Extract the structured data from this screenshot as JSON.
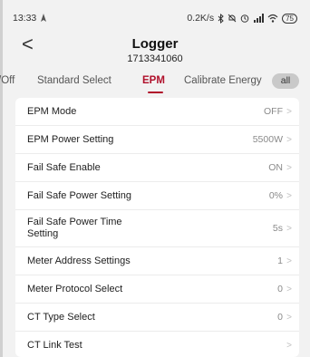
{
  "status_bar": {
    "time": "13:33",
    "speed": "0.2K/s",
    "battery": "75"
  },
  "header": {
    "back_label": "<",
    "title": "Logger",
    "serial": "1713341060"
  },
  "tabs": [
    {
      "label": "/Off",
      "active": false
    },
    {
      "label": "Standard Select",
      "active": false
    },
    {
      "label": "EPM",
      "active": true
    },
    {
      "label": "Calibrate Energy",
      "active": false
    }
  ],
  "all_button": "all",
  "settings": [
    {
      "label": "EPM Mode",
      "value": "OFF"
    },
    {
      "label": "EPM Power Setting",
      "value": "5500W"
    },
    {
      "label": "Fail Safe Enable",
      "value": "ON"
    },
    {
      "label": "Fail Safe Power Setting",
      "value": "0%"
    },
    {
      "label": "Fail Safe Power Time Setting",
      "value": "5s"
    },
    {
      "label": "Meter Address Settings",
      "value": "1"
    },
    {
      "label": "Meter Protocol Select",
      "value": "0"
    },
    {
      "label": "CT Type Select",
      "value": "0"
    },
    {
      "label": "CT Link Test",
      "value": ""
    }
  ],
  "chevron": ">",
  "colors": {
    "accent": "#b0102b",
    "background": "#f2f2f2",
    "card": "#ffffff"
  }
}
